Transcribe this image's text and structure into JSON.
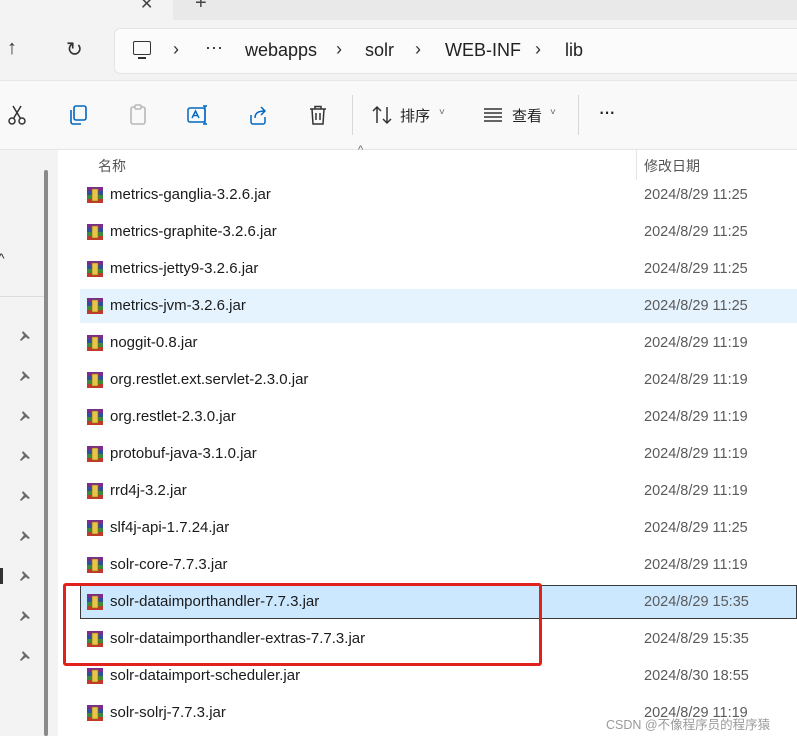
{
  "tabs": {
    "close": "✕",
    "new": "+"
  },
  "nav": {
    "up": "↑",
    "refresh": "↻"
  },
  "breadcrumb": {
    "chevrons": [
      "›",
      "›",
      "›",
      "›",
      "›"
    ],
    "overflow": "···",
    "items": [
      "webapps",
      "solr",
      "WEB-INF",
      "lib"
    ]
  },
  "toolbar": {
    "sort_label": "排序",
    "view_label": "查看",
    "more": "···",
    "caret": "˅",
    "icons": [
      "cut-icon",
      "copy-icon",
      "paste-icon",
      "rename-icon",
      "share-icon",
      "delete-icon",
      "sort-icon",
      "view-icon",
      "more-icon"
    ]
  },
  "columns": {
    "name": "名称",
    "date": "修改日期",
    "sort_indicator": "^"
  },
  "files": [
    {
      "name": "metrics-ganglia-3.2.6.jar",
      "date": "2024/8/29 11:25"
    },
    {
      "name": "metrics-graphite-3.2.6.jar",
      "date": "2024/8/29 11:25"
    },
    {
      "name": "metrics-jetty9-3.2.6.jar",
      "date": "2024/8/29 11:25"
    },
    {
      "name": "metrics-jvm-3.2.6.jar",
      "date": "2024/8/29 11:25",
      "state": "hover"
    },
    {
      "name": "noggit-0.8.jar",
      "date": "2024/8/29 11:19"
    },
    {
      "name": "org.restlet.ext.servlet-2.3.0.jar",
      "date": "2024/8/29 11:19"
    },
    {
      "name": "org.restlet-2.3.0.jar",
      "date": "2024/8/29 11:19"
    },
    {
      "name": "protobuf-java-3.1.0.jar",
      "date": "2024/8/29 11:19"
    },
    {
      "name": "rrd4j-3.2.jar",
      "date": "2024/8/29 11:19"
    },
    {
      "name": "slf4j-api-1.7.24.jar",
      "date": "2024/8/29 11:25"
    },
    {
      "name": "solr-core-7.7.3.jar",
      "date": "2024/8/29 11:19"
    },
    {
      "name": "solr-dataimporthandler-7.7.3.jar",
      "date": "2024/8/29 15:35",
      "state": "selected"
    },
    {
      "name": "solr-dataimporthandler-extras-7.7.3.jar",
      "date": "2024/8/29 15:35"
    },
    {
      "name": "solr-dataimport-scheduler.jar",
      "date": "2024/8/30 18:55"
    },
    {
      "name": "solr-solrj-7.7.3.jar",
      "date": "2024/8/29 11:19"
    }
  ],
  "sidebar": {
    "collapse_glyph": "^",
    "pinned_count": 9
  },
  "watermark": "CSDN @不像程序员的程序猿",
  "colors": {
    "highlight_box": "#e0211c",
    "selected_row": "#cce8ff",
    "hover_row": "#e5f3ff",
    "accent": "#0067c0"
  }
}
